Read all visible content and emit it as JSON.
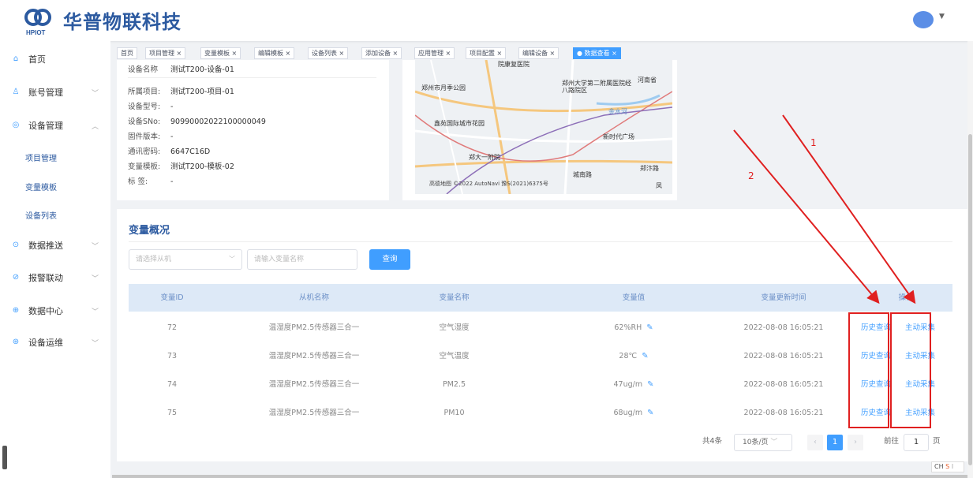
{
  "header": {
    "brand": "华普物联科技",
    "logo_text": "HPIOT"
  },
  "sidebar": {
    "items": [
      {
        "label": "首页",
        "icon": "home-icon"
      },
      {
        "label": "账号管理",
        "icon": "user-icon"
      },
      {
        "label": "设备管理",
        "icon": "device-icon"
      },
      {
        "label": "数据推送",
        "icon": "push-icon"
      },
      {
        "label": "报警联动",
        "icon": "alarm-icon"
      },
      {
        "label": "数据中心",
        "icon": "data-icon"
      },
      {
        "label": "设备运维",
        "icon": "maintain-icon"
      }
    ],
    "sub": [
      "项目管理",
      "变量模板",
      "设备列表"
    ]
  },
  "tabs": [
    "首页",
    "项目管理",
    "变量模板",
    "编辑模板",
    "设备列表",
    "添加设备",
    "应用管理",
    "项目配置",
    "编辑设备",
    "数据查看"
  ],
  "device_info": {
    "rows": [
      {
        "k": "设备名称",
        "v": "测试T200-设备-01"
      },
      {
        "k": "所属项目:",
        "v": "测试T200-项目-01"
      },
      {
        "k": "设备型号:",
        "v": "-"
      },
      {
        "k": "设备SNo:",
        "v": "90990002022100000049"
      },
      {
        "k": "固件版本:",
        "v": "-"
      },
      {
        "k": "通讯密码:",
        "v": "6647C16D"
      },
      {
        "k": "变量模板:",
        "v": "测试T200-模板-02"
      },
      {
        "k": "标 签:",
        "v": "-"
      }
    ]
  },
  "map": {
    "labels": [
      "院康复医院",
      "郑州市月季公园",
      "郑州大学第二附属医院经八路院区",
      "河南省",
      "金水河",
      "鑫苑国际城市花园",
      "新时代广场",
      "郑大一附院",
      "城南路",
      "郑汴路",
      "凤"
    ],
    "copyright": "高德地图 ©2022 AutoNavi 豫S(2021)6375号"
  },
  "main": {
    "title": "变量概况",
    "select_placeholder": "请选择从机",
    "input_placeholder": "请输入变量名称",
    "query": "查询",
    "columns": [
      "变量ID",
      "从机名称",
      "变量名称",
      "变量值",
      "变量更新时间",
      "操作"
    ],
    "rows": [
      {
        "id": "72",
        "slave": "温湿度PM2.5传感器三合一",
        "name": "空气湿度",
        "value": "62%RH",
        "time": "2022-08-08 16:05:21"
      },
      {
        "id": "73",
        "slave": "温湿度PM2.5传感器三合一",
        "name": "空气温度",
        "value": "28℃",
        "time": "2022-08-08 16:05:21"
      },
      {
        "id": "74",
        "slave": "温湿度PM2.5传感器三合一",
        "name": "PM2.5",
        "value": "47ug/m",
        "time": "2022-08-08 16:05:21"
      },
      {
        "id": "75",
        "slave": "温湿度PM2.5传感器三合一",
        "name": "PM10",
        "value": "68ug/m",
        "time": "2022-08-08 16:05:21"
      }
    ],
    "op_history": "历史查询",
    "op_collect": "主动采集"
  },
  "pagination": {
    "total": "共4条",
    "size": "10条/页",
    "page": "1",
    "goto_prefix": "前往",
    "goto_value": "1",
    "goto_suffix": "页"
  },
  "annotations": {
    "n1": "1",
    "n2": "2"
  },
  "ime": "CH"
}
